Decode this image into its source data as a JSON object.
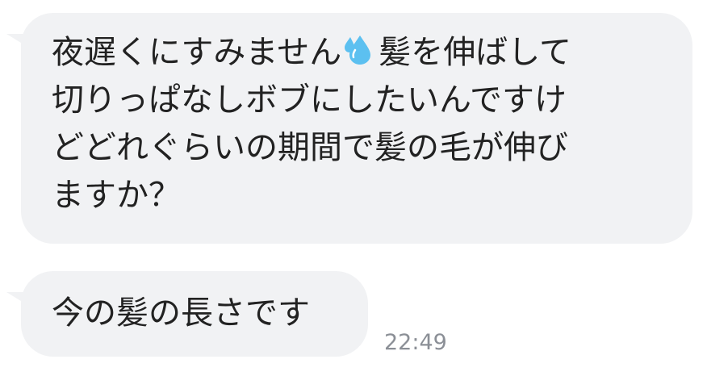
{
  "messages": [
    {
      "lines": [
        "夜遅くにすみません",
        "髪を伸ばして",
        "切りっぱなしボブにしたいんですけ",
        "どどれぐらいの期間で髪の毛が伸び",
        "ますか？"
      ],
      "emoji": "sweat-droplets-icon"
    },
    {
      "lines": [
        "今の髪の長さです"
      ],
      "time": "22:49"
    }
  ],
  "colors": {
    "bubble_background": "#f1f2f4",
    "message_text": "#222222",
    "timestamp_text": "#8b8f96",
    "emoji_blue": "#5cc0f0"
  }
}
